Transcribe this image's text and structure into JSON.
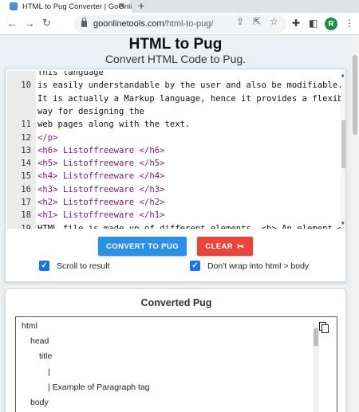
{
  "browser": {
    "tab_title": "HTML to Pug Converter | GoOnlin",
    "tab_close": "✕",
    "new_tab": "+",
    "url_host": "goonlinetools.com",
    "url_path": "/html-to-pug/",
    "profile_initial": "R"
  },
  "page": {
    "title": "HTML to Pug",
    "subtitle": "Convert HTML Code to Pug."
  },
  "editor": {
    "lines": [
      {
        "n": "",
        "text": "This language"
      },
      {
        "n": "10",
        "text": "is easily understandable by the user and also be modifiable."
      },
      {
        "n": "",
        "text": "It is actually a Markup language, hence it provides a flexible"
      },
      {
        "n": "",
        "text": "way for designing the"
      },
      {
        "n": "11",
        "text": "web pages along with the text."
      },
      {
        "n": "12",
        "text": "</p>"
      },
      {
        "n": "13",
        "text": "<h6> Listoffreeware </h6>"
      },
      {
        "n": "14",
        "text": "<h5> Listoffreeware </h5>"
      },
      {
        "n": "15",
        "text": "<h4> Listoffreeware </h4>"
      },
      {
        "n": "16",
        "text": "<h3> Listoffreeware </h3>"
      },
      {
        "n": "17",
        "text": "<h2> Listoffreeware </h2>"
      },
      {
        "n": "18",
        "text": "<h1> Listoffreeware </h1>"
      },
      {
        "n": "19",
        "text": "HTML file is made up of different elements. <b> An element </b"
      }
    ]
  },
  "actions": {
    "convert_label": "CONVERT TO PUG",
    "clear_label": "CLEAR",
    "scroll_to_result_label": "Scroll to result",
    "dont_wrap_label": "Don't wrap into html > body",
    "scroll_to_result_checked": true,
    "dont_wrap_checked": true
  },
  "output": {
    "heading": "Converted Pug",
    "lines": [
      {
        "indent": 0,
        "text": "html"
      },
      {
        "indent": 1,
        "text": "head"
      },
      {
        "indent": 2,
        "text": "title"
      },
      {
        "indent": 3,
        "text": "|"
      },
      {
        "indent": 3,
        "text": "| Example of Paragraph tag"
      },
      {
        "indent": 1,
        "text": "body"
      }
    ]
  },
  "colors": {
    "convert_button": "#2d8fe5",
    "clear_button": "#e8453c",
    "checkbox": "#1a73e8",
    "tag_text": "#7a1a7a"
  }
}
